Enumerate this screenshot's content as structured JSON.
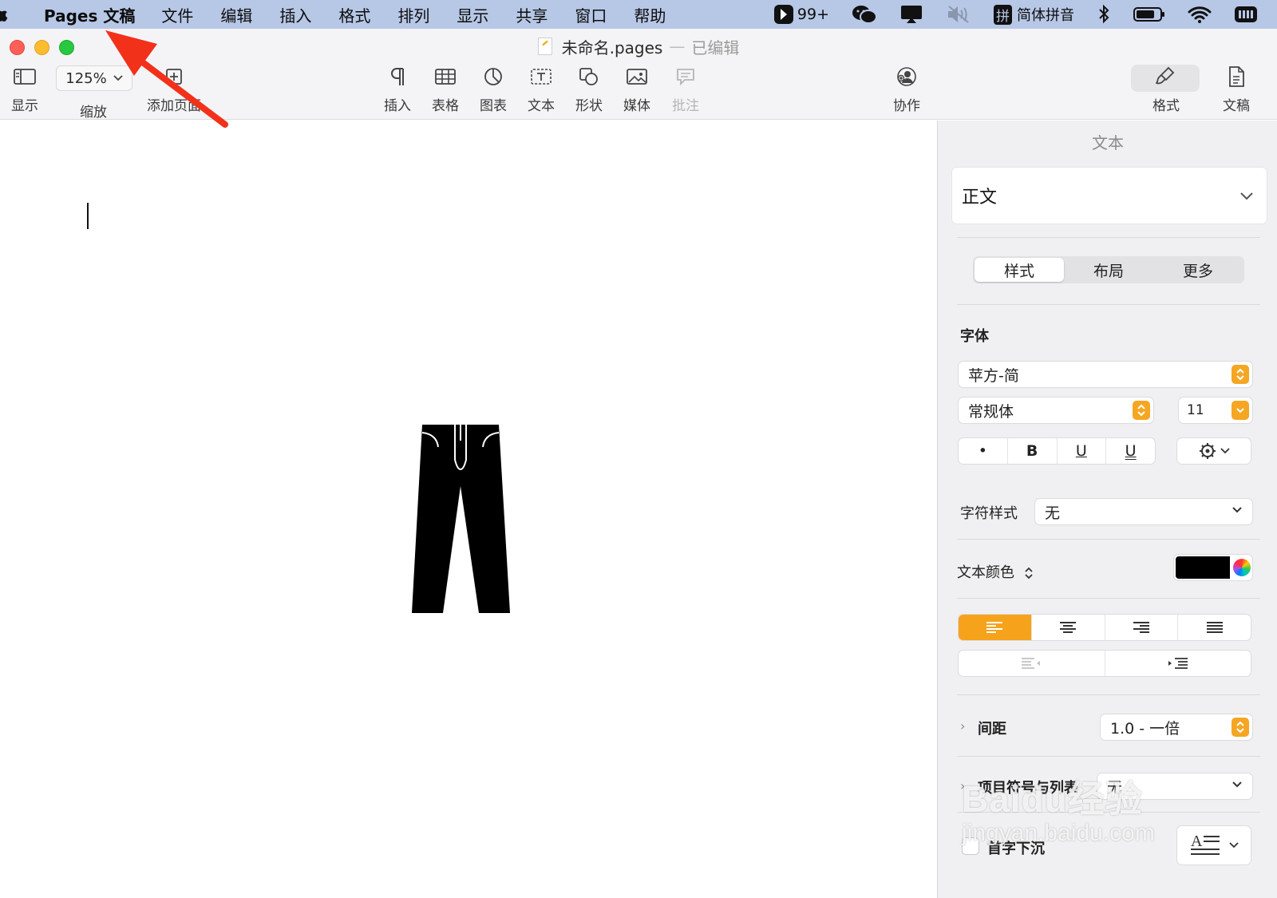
{
  "menubar": {
    "app_name": "Pages 文稿",
    "items": [
      "文件",
      "编辑",
      "插入",
      "格式",
      "排列",
      "显示",
      "共享",
      "窗口",
      "帮助"
    ],
    "status": {
      "notification_count": "99+",
      "input_method_badge": "拼",
      "input_method_label": "简体拼音"
    }
  },
  "window": {
    "document_name": "未命名.pages",
    "title_separator": "—",
    "edit_status": "已编辑"
  },
  "toolbar": {
    "view_label": "显示",
    "zoom_value": "125%",
    "zoom_label": "缩放",
    "add_page_label": "添加页面",
    "insert_label": "插入",
    "table_label": "表格",
    "chart_label": "图表",
    "text_label": "文本",
    "shape_label": "形状",
    "media_label": "媒体",
    "comment_label": "批注",
    "collaborate_label": "协作",
    "format_label": "格式",
    "document_label": "文稿"
  },
  "inspector": {
    "header": "文本",
    "paragraph_style": "正文",
    "tabs": [
      "样式",
      "布局",
      "更多"
    ],
    "selected_tab": "样式",
    "font_section": "字体",
    "font_family": "苹方-简",
    "font_weight": "常规体",
    "font_size": "11",
    "style_buttons": [
      "•",
      "B",
      "U",
      "U"
    ],
    "char_style_label": "字符样式",
    "char_style_value": "无",
    "text_color_label": "文本颜色",
    "text_color": "#000000",
    "alignment": [
      "left",
      "center",
      "right",
      "justify"
    ],
    "selected_alignment": "left",
    "spacing_label": "间距",
    "spacing_value": "1.0 - 一倍",
    "bullets_label": "项目符号与列表",
    "bullets_value": "无",
    "dropcap_label": "首字下沉"
  },
  "canvas": {
    "object": "pants-icon"
  },
  "watermark": {
    "brand": "Baidu经验",
    "domain": "jingyan.baidu.com"
  },
  "colors": {
    "menubar_bg": "#b7c7e6",
    "accent": "#f5a623",
    "annotation_arrow": "#f2311b",
    "toolbar_bg": "#f4f4f6",
    "inspector_bg": "#f0f0f2"
  }
}
